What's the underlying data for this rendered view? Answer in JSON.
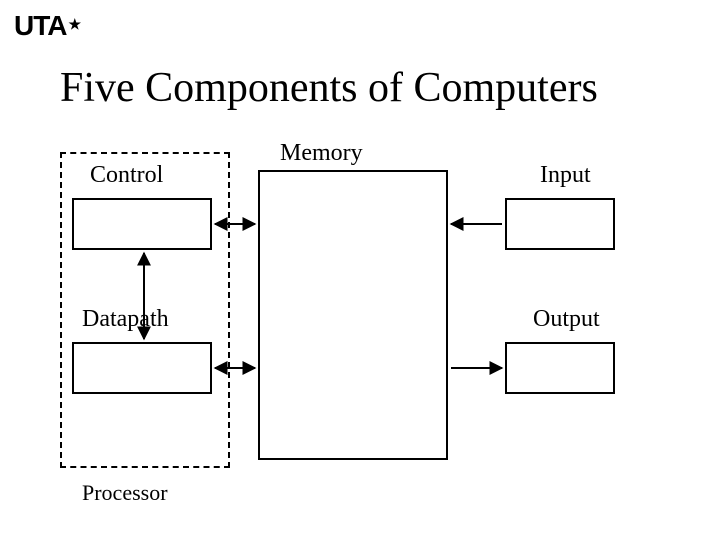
{
  "logo": {
    "text": "UTA",
    "star": "★"
  },
  "title": "Five Components of Computers",
  "labels": {
    "memory": "Memory",
    "control": "Control",
    "datapath": "Datapath",
    "input": "Input",
    "output": "Output",
    "processor": "Processor"
  },
  "chart_data": {
    "type": "diagram",
    "title": "Five Components of Computers",
    "nodes": [
      {
        "id": "processor",
        "label": "Processor",
        "group": true,
        "children": [
          "control",
          "datapath"
        ]
      },
      {
        "id": "control",
        "label": "Control"
      },
      {
        "id": "datapath",
        "label": "Datapath"
      },
      {
        "id": "memory",
        "label": "Memory"
      },
      {
        "id": "input",
        "label": "Input"
      },
      {
        "id": "output",
        "label": "Output"
      }
    ],
    "edges": [
      {
        "from": "control",
        "to": "memory",
        "bidirectional": true
      },
      {
        "from": "datapath",
        "to": "memory",
        "bidirectional": true
      },
      {
        "from": "control",
        "to": "datapath",
        "bidirectional": true
      },
      {
        "from": "input",
        "to": "memory",
        "bidirectional": false
      },
      {
        "from": "memory",
        "to": "output",
        "bidirectional": false
      }
    ]
  }
}
